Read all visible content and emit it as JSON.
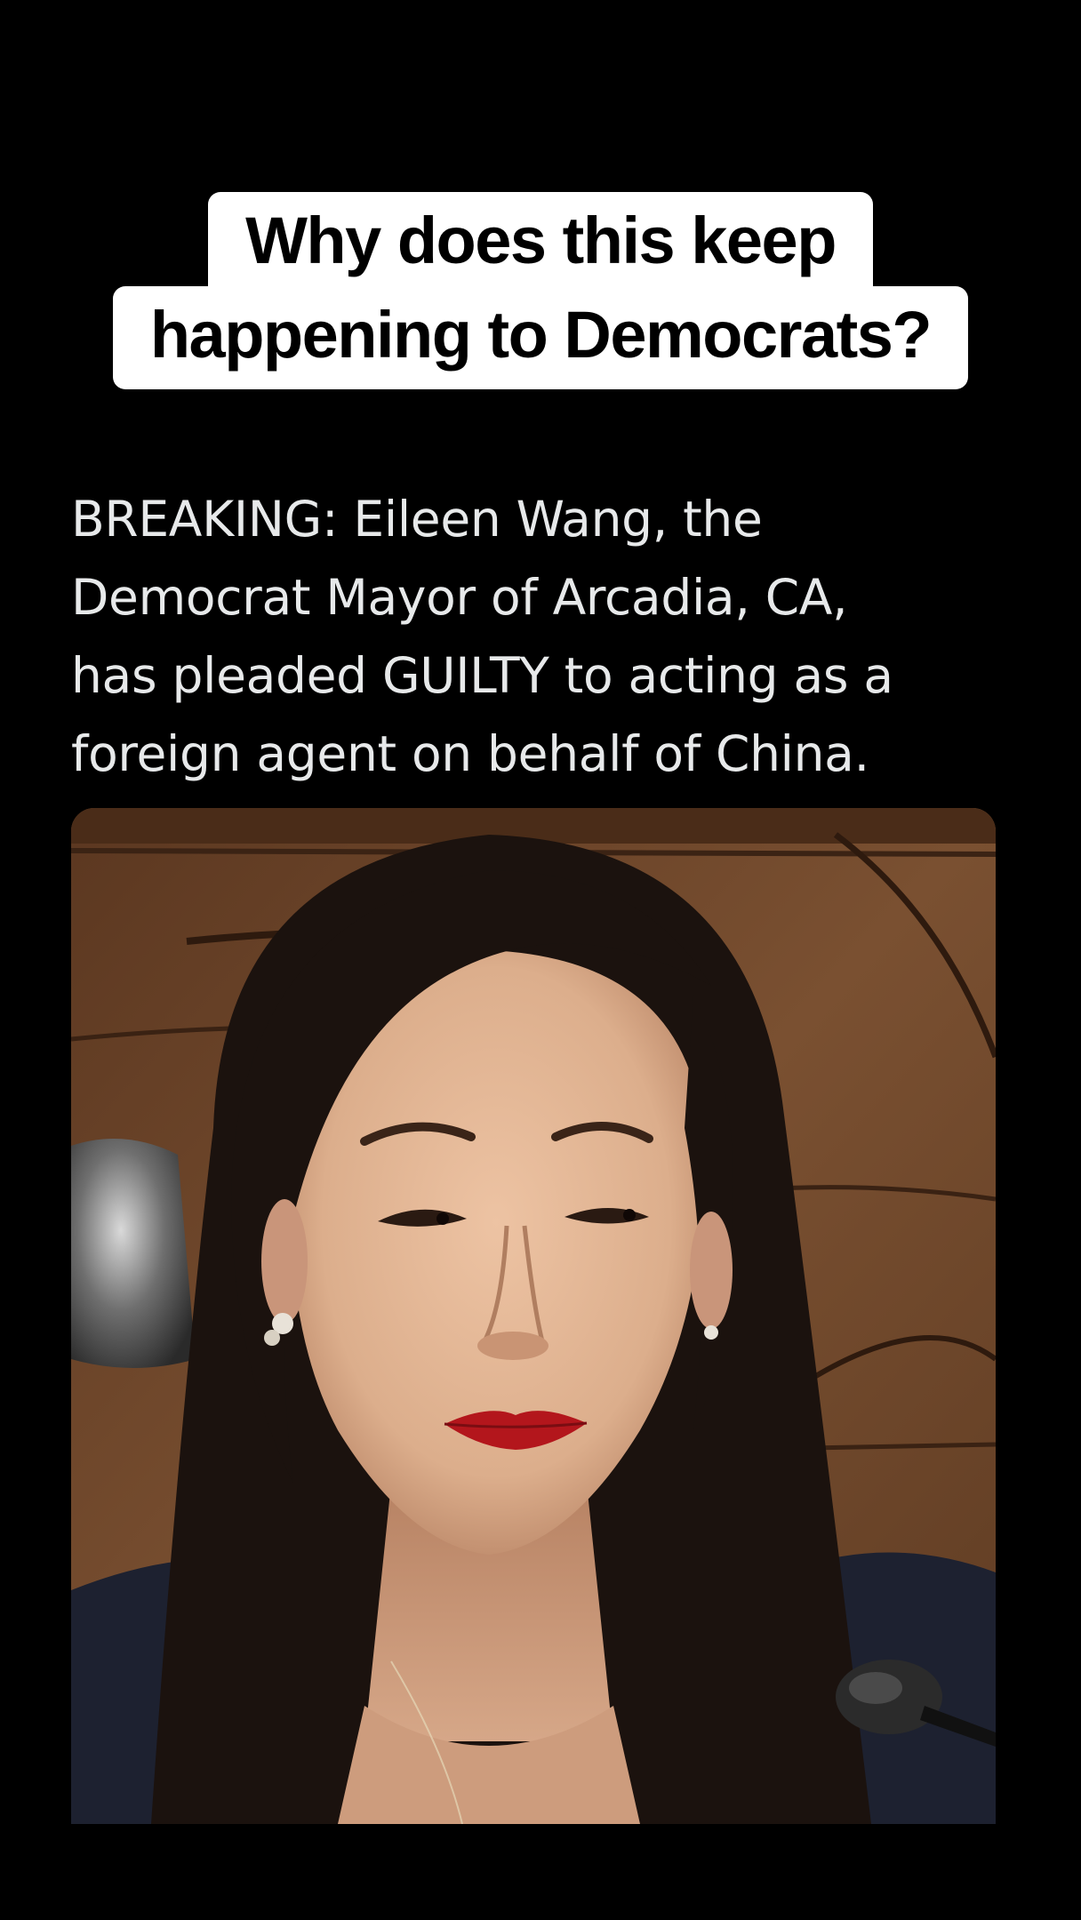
{
  "caption": {
    "line1": "Why does this keep",
    "line2": "happening to Democrats?"
  },
  "post": {
    "lines": [
      "BREAKING: Eileen Wang, the",
      "Democrat Mayor of Arcadia, CA,",
      "has pleaded GUILTY to acting as a",
      "foreign agent on behalf of China."
    ]
  },
  "photo": {
    "subject": "woman-portrait-photo",
    "colors": {
      "wood": "#6b4426",
      "skin": "#e3b797",
      "hair": "#1b120e",
      "lips": "#b3161c",
      "jacket": "#1d2130"
    }
  }
}
